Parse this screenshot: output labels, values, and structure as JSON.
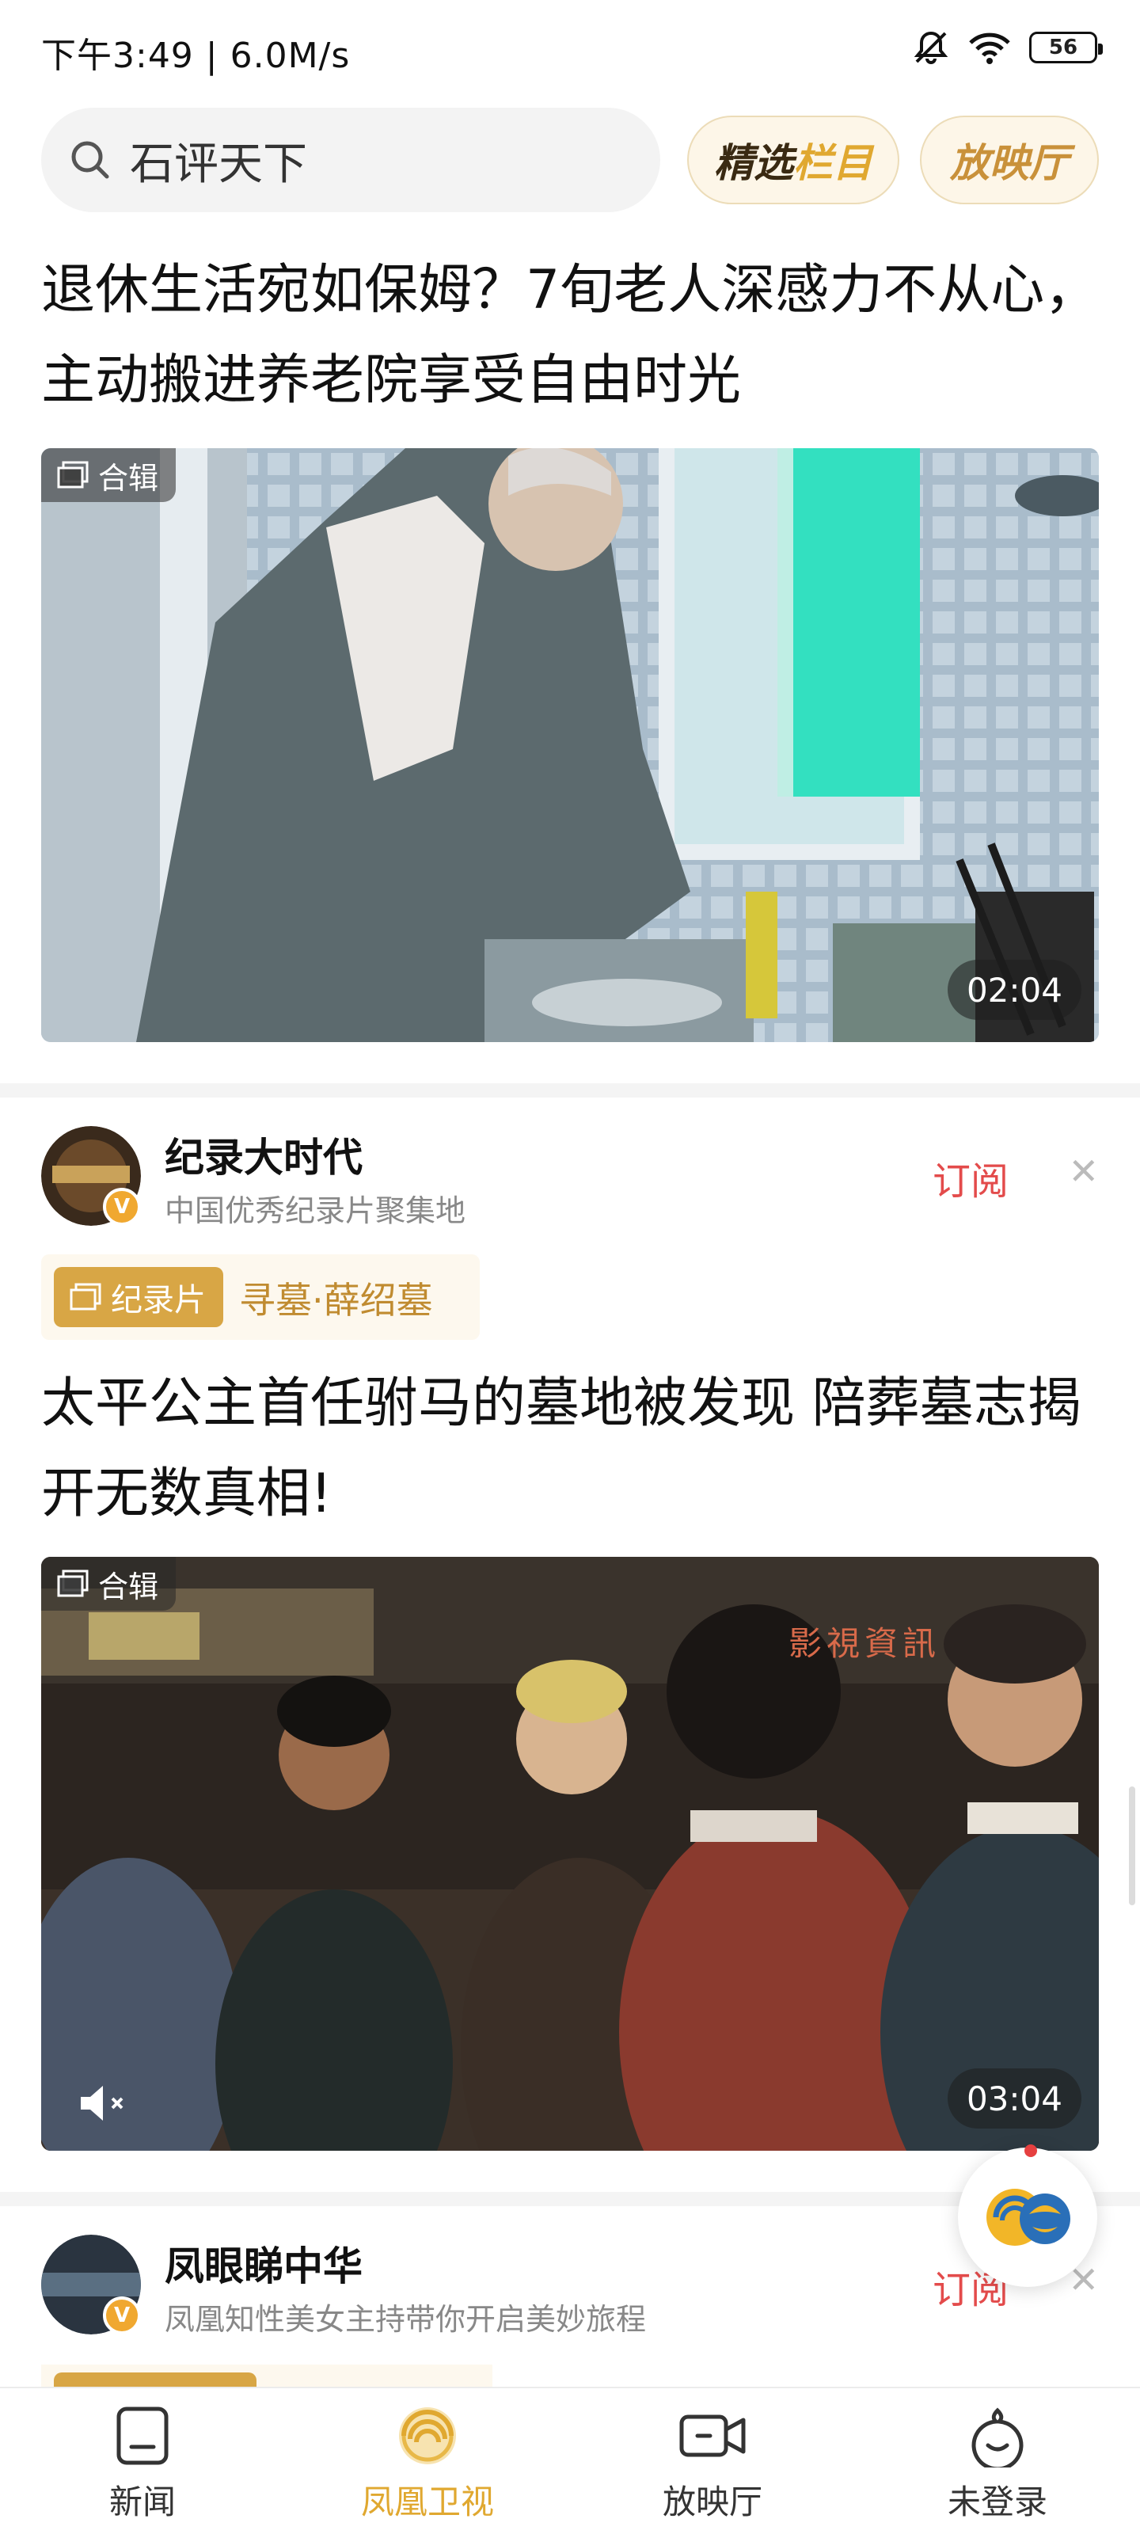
{
  "status_bar": {
    "time_speed": "下午3:49 | 6.0M/s",
    "battery": "56"
  },
  "header": {
    "search_text": "石评天下",
    "featured_dark": "精选",
    "featured_gold": "栏目",
    "cinema": "放映厅"
  },
  "feed": [
    {
      "title": "退休生活宛如保姆？7旬老人深感力不从心，主动搬进养老院享受自由时光",
      "collection_tag": "合辑",
      "duration": "02:04"
    },
    {
      "author": {
        "name": "纪录大时代",
        "desc": "中国优秀纪录片聚集地"
      },
      "subscribe": "订阅",
      "category_tag": "纪录片",
      "category_title": "寻墓·薛绍墓",
      "title": "太平公主首任驸马的墓地被发现 陪葬墓志揭开无数真相!",
      "collection_tag": "合辑",
      "duration": "03:04",
      "watermark": "影視資訊"
    },
    {
      "author": {
        "name": "凤眼睇中华",
        "desc": "凤凰知性美女主持带你开启美妙旅程"
      },
      "subscribe": "订阅"
    }
  ],
  "verified_mark": "V",
  "nav": {
    "items": [
      {
        "label": "新闻"
      },
      {
        "label": "凤凰卫视"
      },
      {
        "label": "放映厅"
      },
      {
        "label": "未登录"
      }
    ]
  },
  "colors": {
    "accent_gold": "#e0a830",
    "subscribe_red": "#e34b4b"
  }
}
